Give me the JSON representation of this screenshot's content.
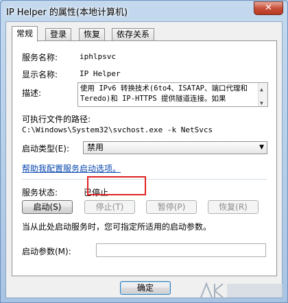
{
  "window": {
    "title": "IP Helper 的属性(本地计算机)",
    "close_label": "✕"
  },
  "tabs": [
    {
      "label": "常规",
      "active": true
    },
    {
      "label": "登录",
      "active": false
    },
    {
      "label": "恢复",
      "active": false
    },
    {
      "label": "依存关系",
      "active": false
    }
  ],
  "general": {
    "service_name_label": "服务名称:",
    "service_name": "iphlpsvc",
    "display_name_label": "显示名称:",
    "display_name": "IP Helper",
    "description_label": "描述:",
    "description": "使用 IPv6 转换技术(6to4、ISATAP、端口代理和 Teredo)和 IP-HTTPS 提供隧道连接。如果",
    "exe_path_label": "可执行文件的路径:",
    "exe_path": "C:\\Windows\\System32\\svchost.exe -k NetSvcs",
    "startup_type_label": "启动类型(E):",
    "startup_type_value": "禁用",
    "help_link": "帮助我配置服务启动选项。",
    "status_label": "服务状态:",
    "status_value": "已停止",
    "start_button": "启动(S)",
    "stop_button": "停止(T)",
    "pause_button": "暂停(P)",
    "resume_button": "恢复(R)",
    "start_hint": "当从此处启动服务时，您可指定所适用的启动参数。",
    "start_params_label": "启动参数(M):",
    "start_params_value": ""
  },
  "footer": {
    "ok_button": "确定"
  }
}
